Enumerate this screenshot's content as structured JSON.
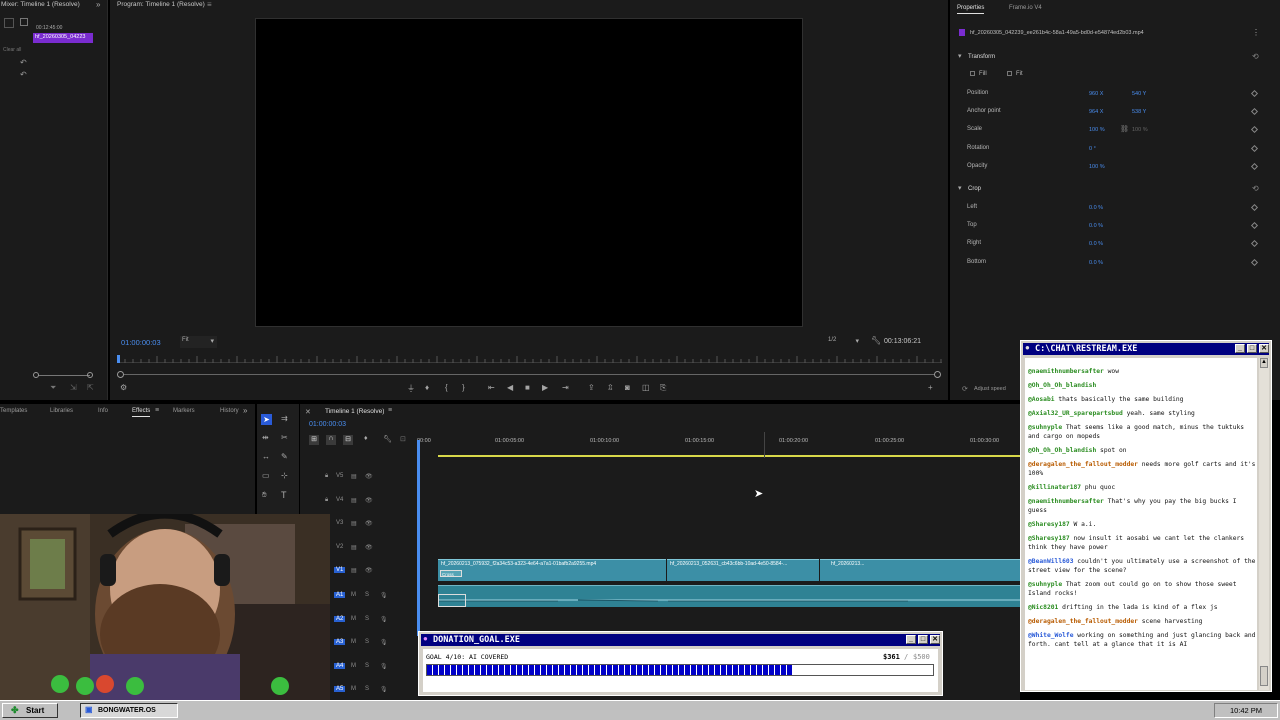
{
  "source_panel": {
    "title": "Mixer: Timeline 1 (Resolve)",
    "clip_time": "00:12:45:00",
    "clip_name": "hf_20260305_04223",
    "clear_all": "Clear all"
  },
  "program": {
    "title": "Program: Timeline 1 (Resolve)",
    "timecode": "01:00:00:03",
    "fit": "Fit",
    "resolution": "1/2",
    "duration": "00:13:06:21"
  },
  "properties": {
    "tabs": [
      "Properties",
      "Frame.io V4"
    ],
    "active_tab": "Properties",
    "filename": "hf_20260305_042239_ee261b4c-58a1-49a5-bd0d-e54874ed2b03.mp4",
    "transform_label": "Transform",
    "fill_label": "Fill",
    "fit_label": "Fit",
    "position_label": "Position",
    "position_x": "960 X",
    "position_y": "540 Y",
    "anchor_label": "Anchor point",
    "anchor_x": "964 X",
    "anchor_y": "538 Y",
    "scale_label": "Scale",
    "scale_val": "100 %",
    "scale_val2": "100 %",
    "rotation_label": "Rotation",
    "rotation_val": "0 °",
    "opacity_label": "Opacity",
    "opacity_val": "100 %",
    "crop_label": "Crop",
    "left_label": "Left",
    "left_val": "0.0 %",
    "top_label": "Top",
    "top_val": "0.0 %",
    "right_label": "Right",
    "right_val": "0.0 %",
    "bottom_label": "Bottom",
    "bottom_val": "0.0 %",
    "adjust_speed": "Adjust speed"
  },
  "effects_tabs": [
    "Templates",
    "Libraries",
    "Info",
    "Effects",
    "Markers",
    "History"
  ],
  "effects_active": "Effects",
  "timeline": {
    "title": "Timeline 1 (Resolve)",
    "timecode": "01:00:00:03",
    "ruler": [
      "00:00",
      "01:00:05:00",
      "01:00:10:00",
      "01:00:15:00",
      "01:00:20:00",
      "01:00:25:00",
      "01:00:30:00"
    ],
    "video_tracks": [
      "V5",
      "V4",
      "V3",
      "V2",
      "V1"
    ],
    "audio_tracks": [
      "A1",
      "A2",
      "A3",
      "A4",
      "A5"
    ],
    "clip1": "hf_20260213_075932_f2a34c53-a323-4e64-a7a1-01bafb2a9255.mp4",
    "clip2": "hf_20260213_052631_cb43c6bb-10ad-4e50-8584-...",
    "clip3": "hf_20260213...",
    "cross": "Cross"
  },
  "chat": {
    "title": "C:\\CHAT\\RESTREAM.EXE",
    "messages": [
      {
        "user": "@naemithnumbersafter",
        "text": "wow",
        "color": "green"
      },
      {
        "user": "@Oh_Oh_Oh_blandish",
        "text": "",
        "color": "green"
      },
      {
        "user": "@Aosabi",
        "text": "thats basically the same building",
        "color": "green"
      },
      {
        "user": "@Axial32_UR_sparepartsbud",
        "text": "yeah. same styling",
        "color": "green"
      },
      {
        "user": "@suhnyple",
        "text": "That seems like a good match, minus the tuktuks and cargo on mopeds",
        "color": "green"
      },
      {
        "user": "@Oh_Oh_Oh_blandish",
        "text": "spot on",
        "color": "green"
      },
      {
        "user": "@deragalen_the_fallout_modder",
        "text": "needs more golf carts and it's 100%",
        "color": "orange"
      },
      {
        "user": "@killinater187",
        "text": "phu quoc",
        "color": "green"
      },
      {
        "user": "@naemithnumbersafter",
        "text": "That's why you pay the big bucks I guess",
        "color": "green"
      },
      {
        "user": "@Sharesy187",
        "text": "W a.i.",
        "color": "green"
      },
      {
        "user": "@Sharesy187",
        "text": "now insult it aosabi we cant let the clankers think they have power",
        "color": "green"
      },
      {
        "user": "@BeanWill603",
        "text": "couldn't you ultimately use a screenshot of the street view for the scene?",
        "color": "blue"
      },
      {
        "user": "@suhnyple",
        "text": "That zoom out could go on to show those sweet Island rocks!",
        "color": "green"
      },
      {
        "user": "@Nic8201",
        "text": "drifting in the lada is kind of a flex js",
        "color": "green"
      },
      {
        "user": "@deragalen_the_fallout_modder",
        "text": "scene harvesting",
        "color": "orange"
      },
      {
        "user": "@White_Wolfe",
        "text": "working on something and just glancing back and forth. cant tell at a glance that it is AI",
        "color": "blue"
      }
    ]
  },
  "donation": {
    "title": "DONATION_GOAL.EXE",
    "goal_label": "GOAL 4/10: AI COVERED",
    "raised": "$361",
    "separator": "/",
    "target": "$500",
    "progress": 0.722
  },
  "taskbar": {
    "start": "Start",
    "task": "BONGWATER.OS",
    "clock": "10:42 PM"
  },
  "colors": {
    "accent_blue": "#4a8ef0",
    "win_title": "#000080",
    "clip_teal": "#3c8fa6",
    "progress_blue": "#0000c8"
  }
}
